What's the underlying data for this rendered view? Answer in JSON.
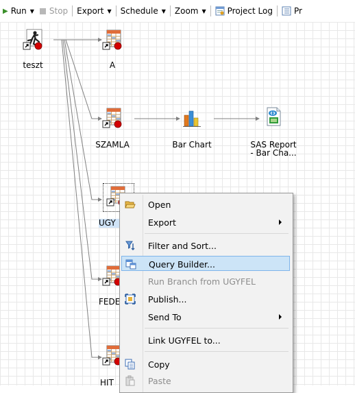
{
  "toolbar": {
    "run": "Run",
    "stop": "Stop",
    "export": "Export",
    "schedule": "Schedule",
    "zoom": "Zoom",
    "project_log": "Project Log",
    "truncated": "Pr"
  },
  "nodes": {
    "teszt": "teszt",
    "a": "A",
    "szamla": "SZAMLA",
    "bar_chart": "Bar Chart",
    "sas_report_line1": "SAS Report",
    "sas_report_line2": "- Bar Cha...",
    "ugyfel_partial": "UGY",
    "fede_partial": "FEDE",
    "hit_partial": "HIT"
  },
  "context_menu": {
    "open": "Open",
    "export": "Export",
    "filter_sort": "Filter and Sort...",
    "query_builder": "Query Builder...",
    "run_branch": "Run Branch from UGYFEL",
    "publish": "Publish...",
    "send_to": "Send To",
    "link": "Link UGYFEL to...",
    "copy": "Copy",
    "paste": "Paste"
  },
  "colors": {
    "highlight": "#cce4f7",
    "highlight_border": "#7eb4ea",
    "link_line": "#808080",
    "status_red": "#d40000"
  }
}
